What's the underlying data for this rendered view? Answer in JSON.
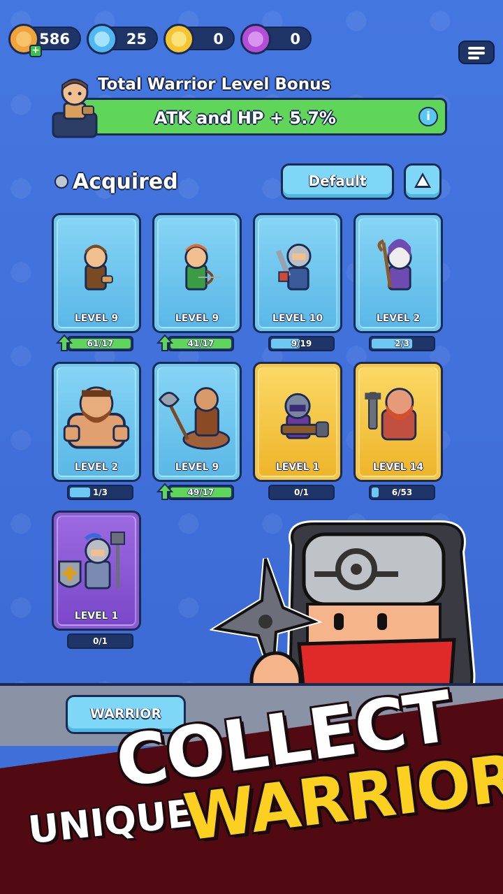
{
  "currencies": [
    {
      "name": "gold-coin",
      "value": "586",
      "color": "#f0a33b",
      "has_plus": true
    },
    {
      "name": "blue-gem",
      "value": "25",
      "color": "#4fb7f2",
      "has_plus": false
    },
    {
      "name": "yellow-token",
      "value": "0",
      "color": "#f5c531",
      "has_plus": false
    },
    {
      "name": "purple-orb",
      "value": "0",
      "color": "#b24fd6",
      "has_plus": false
    }
  ],
  "bonus": {
    "title": "Total Warrior Level Bonus",
    "text": "ATK and HP + 5.7%",
    "info_icon": "i"
  },
  "filter": {
    "label": "Acquired",
    "sort_label": "Default"
  },
  "cards": [
    {
      "level": "LEVEL 9",
      "progress": "61/17",
      "rarity": "blue",
      "upgrade": true,
      "fill": 1.0
    },
    {
      "level": "LEVEL 9",
      "progress": "41/17",
      "rarity": "blue",
      "upgrade": true,
      "fill": 1.0
    },
    {
      "level": "LEVEL 10",
      "progress": "9/19",
      "rarity": "blue",
      "upgrade": false,
      "fill": 0.47
    },
    {
      "level": "LEVEL 2",
      "progress": "2/3",
      "rarity": "blue",
      "upgrade": false,
      "fill": 0.67
    },
    {
      "level": "LEVEL 2",
      "progress": "1/3",
      "rarity": "blue",
      "upgrade": false,
      "fill": 0.33
    },
    {
      "level": "LEVEL 9",
      "progress": "49/17",
      "rarity": "blue",
      "upgrade": true,
      "fill": 1.0
    },
    {
      "level": "LEVEL 1",
      "progress": "0/1",
      "rarity": "gold",
      "upgrade": false,
      "fill": 0.0
    },
    {
      "level": "LEVEL 14",
      "progress": "6/53",
      "rarity": "gold",
      "upgrade": false,
      "fill": 0.11
    },
    {
      "level": "LEVEL 1",
      "progress": "0/1",
      "rarity": "purple",
      "upgrade": false,
      "fill": 0.0
    }
  ],
  "tabs": {
    "warrior": "WARRIOR"
  },
  "promo": {
    "line1": "COLLECT",
    "line2": "UNIQUE",
    "line3": "WARRIORS"
  }
}
